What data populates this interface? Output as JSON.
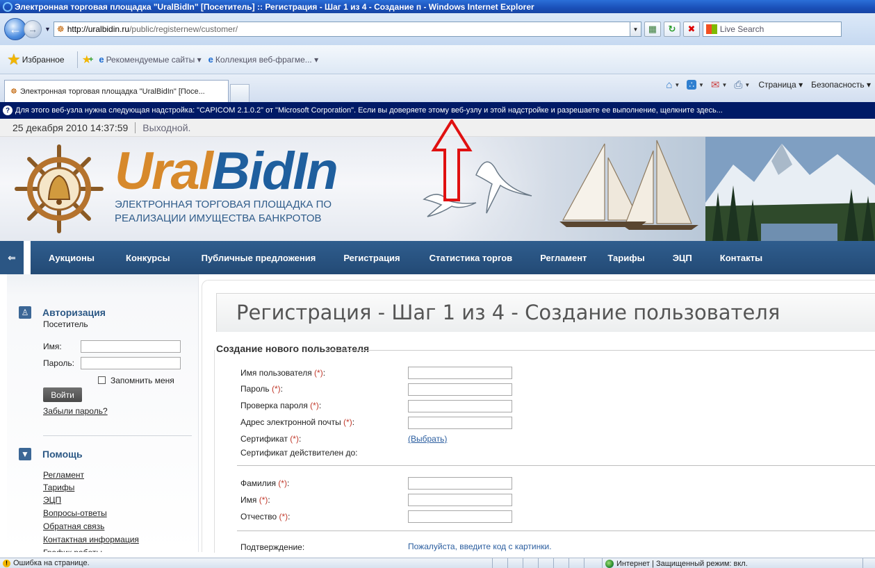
{
  "browser": {
    "window_title": "Электронная торговая площадка \"UralBidIn\" [Посетитель] :: Регистрация - Шаг 1 из 4 - Создание п - Windows Internet Explorer",
    "url_domain": "http://uralbidin.ru",
    "url_path": "/public/registernew/customer/",
    "search_placeholder": "Live Search",
    "favorites_label": "Избранное",
    "fav_items": [
      "Рекомендуемые сайты ▾",
      "Коллекция веб-фрагме... ▾"
    ],
    "tab_title": "Электронная торговая площадка \"UralBidIn\" [Посе...",
    "cmd_page": "Страница ▾",
    "cmd_security": "Безопасность ▾",
    "infobar_text": "Для этого веб-узла нужна следующая надстройка: \"CAPICOM 2.1.0.2\" от \"Microsoft Corporation\". Если вы доверяете этому веб-узлу и этой надстройке и разрешаете ее выполнение, щелкните здесь...",
    "status_error": "Ошибка на странице.",
    "status_zone": "Интернет | Защищенный режим: вкл."
  },
  "page": {
    "date": "25 декабря 2010 14:37:59",
    "day_status": "Выходной.",
    "logo_ural": "Ural",
    "logo_bidin": "BidIn",
    "logo_sub_1": "ЭЛЕКТРОННАЯ ТОРГОВАЯ ПЛОЩАДКА ПО",
    "logo_sub_2": "РЕАЛИЗАЦИИ ИМУЩЕСТВА БАНКРОТОВ",
    "nav": [
      "Аукционы",
      "Конкурсы",
      "Публичные предложения",
      "Регистрация",
      "Статистика торгов",
      "Регламент",
      "Тарифы",
      "ЭЦП",
      "Контакты"
    ]
  },
  "sidebar": {
    "auth_title": "Авторизация",
    "auth_role": "Посетитель",
    "name_label": "Имя:",
    "password_label": "Пароль:",
    "remember_label": "Запомнить меня",
    "login_button": "Войти",
    "forgot_link": "Забыли пароль?",
    "help_title": "Помощь",
    "help_links": [
      "Регламент",
      "Тарифы",
      "ЭЦП",
      "Вопросы-ответы",
      "Обратная связь",
      "Контактная информация",
      "График работы"
    ]
  },
  "form": {
    "title": "Регистрация - Шаг 1 из 4 - Создание пользователя",
    "legend": "Создание нового пользователя",
    "required_mark": "(*)",
    "username_label": "Имя пользователя ",
    "password_label": "Пароль ",
    "password_confirm_label": "Проверка пароля ",
    "email_label": "Адрес электронной почты ",
    "certificate_label": "Сертификат ",
    "choose_link": "(Выбрать)",
    "cert_valid_label": "Сертификат действителен до:",
    "surname_label": "Фамилия ",
    "firstname_label": "Имя ",
    "patronymic_label": "Отчество ",
    "confirm_label": "Подтверждение:",
    "captcha_prompt": "Пожалуйста, введите код с картинки."
  }
}
